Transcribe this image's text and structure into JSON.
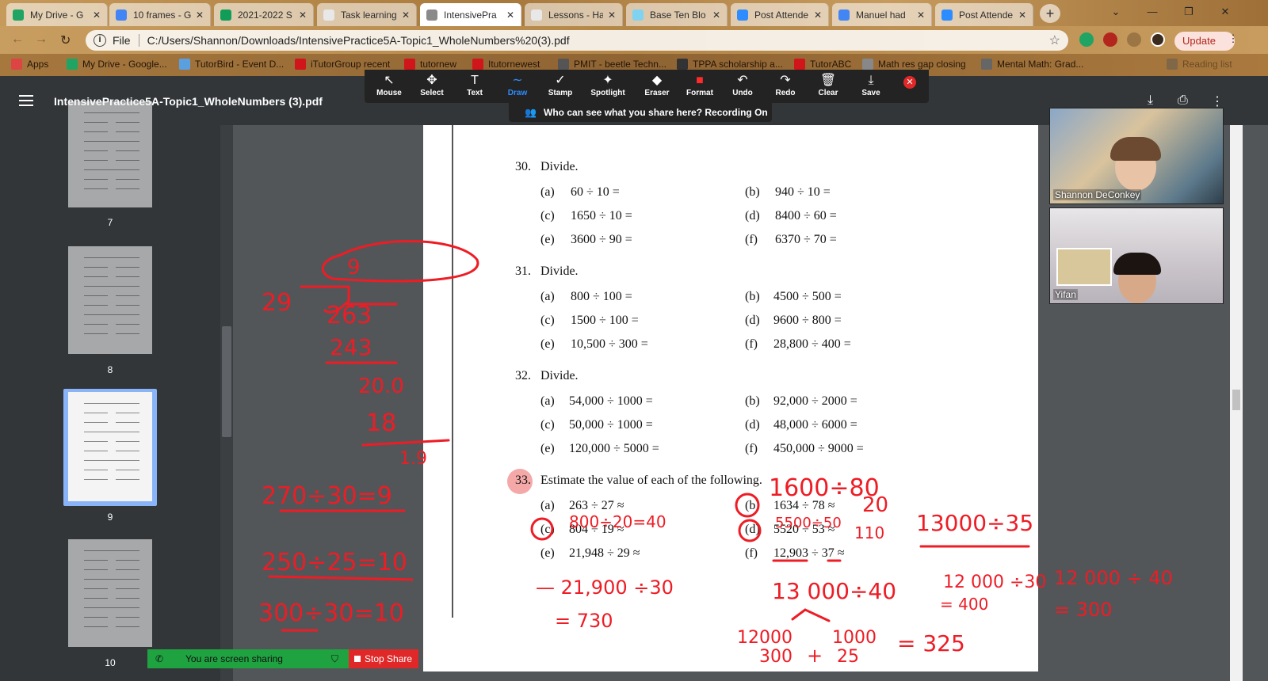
{
  "browser": {
    "tabs": [
      {
        "label": "My Drive - G",
        "icon": "google-drive-icon",
        "color": "#1fa463"
      },
      {
        "label": "10 frames - G",
        "icon": "google-docs-icon",
        "color": "#4285f4"
      },
      {
        "label": "2021-2022 S",
        "icon": "google-sheets-icon",
        "color": "#0f9d58"
      },
      {
        "label": "Task learning",
        "icon": "task-icon",
        "color": "#e8e8e8"
      },
      {
        "label": "IntensivePra",
        "icon": "pdf-icon",
        "color": "#8a8a8a"
      },
      {
        "label": "Lessons - Ha",
        "icon": "lessons-icon",
        "color": "#e8e8e8"
      },
      {
        "label": "Base Ten Blo",
        "icon": "base-ten-icon",
        "color": "#7fd3f0"
      },
      {
        "label": "Post Attende",
        "icon": "zoom-icon",
        "color": "#2d8cff"
      },
      {
        "label": "Manuel had",
        "icon": "google-docs-icon",
        "color": "#4285f4"
      },
      {
        "label": "Post Attende",
        "icon": "zoom-icon",
        "color": "#2d8cff"
      }
    ],
    "active_tab": 4,
    "address": {
      "scheme": "File",
      "url": "C:/Users/Shannon/Downloads/IntensivePractice5A-Topic1_WholeNumbers%20(3).pdf"
    },
    "update_label": "Update",
    "bookmarks": [
      {
        "label": "Apps",
        "color": "#d44"
      },
      {
        "label": "My Drive - Google...",
        "color": "#1fa463"
      },
      {
        "label": "TutorBird - Event D...",
        "color": "#5aa0e0"
      },
      {
        "label": "iTutorGroup recent",
        "color": "#d0151b"
      },
      {
        "label": "tutornew",
        "color": "#d0151b"
      },
      {
        "label": "Itutornewest",
        "color": "#d0151b"
      },
      {
        "label": "PMIT - beetle Techn...",
        "color": "#555"
      },
      {
        "label": "TPPA scholarship a...",
        "color": "#333"
      },
      {
        "label": "TutorABC",
        "color": "#d0151b"
      },
      {
        "label": "Math res gap closing",
        "color": "#888"
      },
      {
        "label": "Mental Math: Grad...",
        "color": "#666"
      },
      {
        "label": "Reading list",
        "color": "#555"
      }
    ]
  },
  "pdf": {
    "title": "IntensivePractice5A-Topic1_WholeNumbers (3).pdf",
    "thumbnails": [
      "7",
      "8",
      "9",
      "10"
    ],
    "active_thumbnail": 2
  },
  "zoom_toolbar": {
    "tools": [
      {
        "label": "Mouse",
        "glyph": "↖"
      },
      {
        "label": "Select",
        "glyph": "✥"
      },
      {
        "label": "Text",
        "glyph": "T"
      },
      {
        "label": "Draw",
        "glyph": "∼"
      },
      {
        "label": "Stamp",
        "glyph": "✓"
      },
      {
        "label": "Spotlight",
        "glyph": "✦"
      },
      {
        "label": "Eraser",
        "glyph": "◆"
      },
      {
        "label": "Format",
        "glyph": "■"
      },
      {
        "label": "Undo",
        "glyph": "↶"
      },
      {
        "label": "Redo",
        "glyph": "↷"
      },
      {
        "label": "Clear",
        "glyph": "🗑"
      },
      {
        "label": "Save",
        "glyph": "⤓"
      }
    ],
    "active_tool": 3,
    "recording_notice": "Who can see what you share here? Recording On"
  },
  "document": {
    "questions": [
      {
        "num": "30.",
        "prompt": "Divide.",
        "items": [
          [
            "(a)",
            "60 ÷ 10 ="
          ],
          [
            "(b)",
            "940 ÷ 10 ="
          ],
          [
            "(c)",
            "1650 ÷ 10 ="
          ],
          [
            "(d)",
            "8400 ÷ 60 ="
          ],
          [
            "(e)",
            "3600 ÷ 90 ="
          ],
          [
            "(f)",
            "6370 ÷ 70 ="
          ]
        ]
      },
      {
        "num": "31.",
        "prompt": "Divide.",
        "items": [
          [
            "(a)",
            "800 ÷ 100 ="
          ],
          [
            "(b)",
            "4500 ÷ 500 ="
          ],
          [
            "(c)",
            "1500 ÷ 100 ="
          ],
          [
            "(d)",
            "9600 ÷ 800 ="
          ],
          [
            "(e)",
            "10,500 ÷ 300 ="
          ],
          [
            "(f)",
            "28,800 ÷ 400 ="
          ]
        ]
      },
      {
        "num": "32.",
        "prompt": "Divide.",
        "items": [
          [
            "(a)",
            "54,000 ÷ 1000 ="
          ],
          [
            "(b)",
            "92,000 ÷ 2000 ="
          ],
          [
            "(c)",
            "50,000 ÷ 1000 ="
          ],
          [
            "(d)",
            "48,000 ÷ 6000 ="
          ],
          [
            "(e)",
            "120,000 ÷ 5000 ="
          ],
          [
            "(f)",
            "450,000 ÷ 9000 ="
          ]
        ]
      },
      {
        "num": "33.",
        "prompt": "Estimate the value of each of the following.",
        "items": [
          [
            "(a)",
            "263 ÷ 27 ≈"
          ],
          [
            "(b)",
            "1634 ÷ 78 ≈"
          ],
          [
            "(c)",
            "804 ÷ 19 ≈"
          ],
          [
            "(d)",
            "5520 ÷ 53 ≈"
          ],
          [
            "(e)",
            "21,948 ÷ 29 ≈"
          ],
          [
            "(f)",
            "12,903 ÷ 37 ≈"
          ]
        ]
      }
    ]
  },
  "annotations": {
    "color": "#ee1c25",
    "texts": [
      "9",
      "29",
      "263",
      "243",
      "20.0",
      "18",
      "1.9",
      "270÷30=9",
      "250÷25=10",
      "300÷30=10",
      "800÷20=40",
      "1600÷80",
      "20",
      "5500÷50",
      "110",
      "13000÷35",
      "— 21,900 ÷30",
      "= 730",
      "13 000÷40",
      "12000",
      "1000",
      "300",
      "+",
      "25",
      "= 325",
      "12 000 ÷30",
      "= 400",
      "12 000 ÷ 40",
      "= 300"
    ]
  },
  "video": {
    "participants": [
      {
        "name": "Shannon DeConkey"
      },
      {
        "name": "Yifan"
      }
    ]
  },
  "share_bar": {
    "status": "You are screen sharing",
    "stop_label": "Stop Share"
  }
}
